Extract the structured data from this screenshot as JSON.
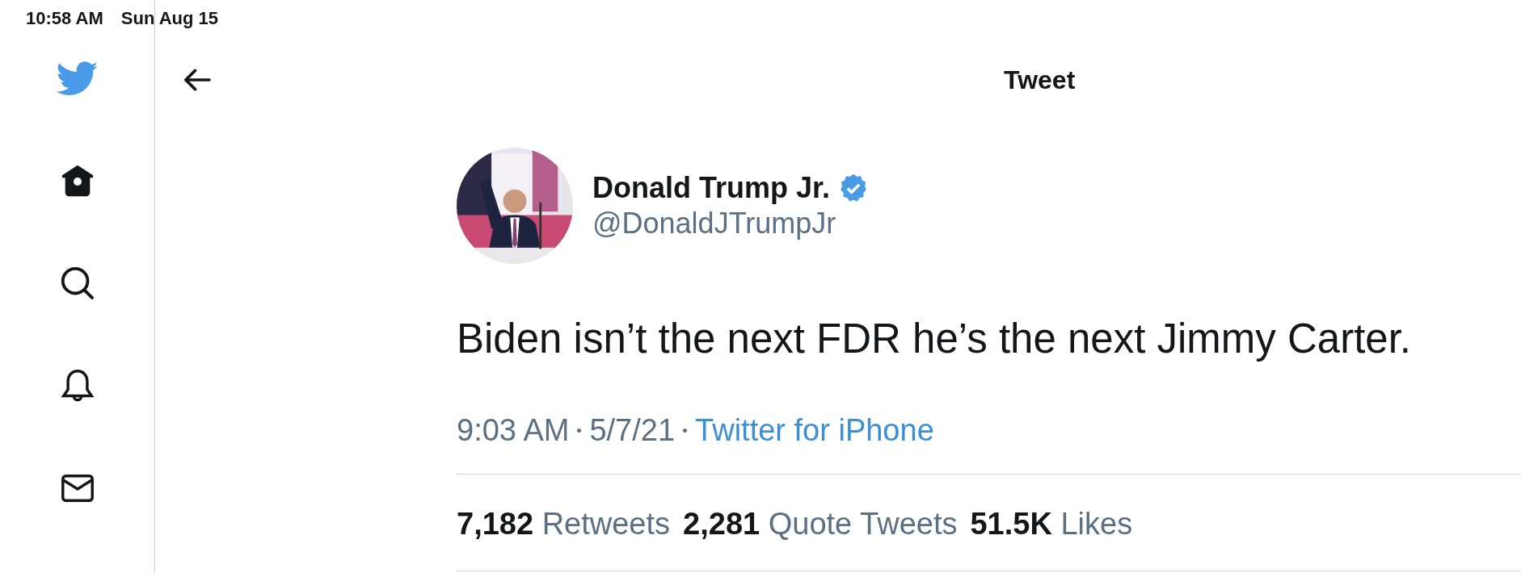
{
  "status_bar": {
    "time": "10:58 AM",
    "date": "Sun Aug 15"
  },
  "header": {
    "title": "Tweet"
  },
  "tweet": {
    "author": {
      "name": "Donald Trump Jr.",
      "verified": true,
      "handle": "@DonaldJTrumpJr"
    },
    "text": "Biden isn’t the next FDR he’s the next Jimmy Carter.",
    "time": "9:03 AM",
    "date": "5/7/21",
    "source": "Twitter for iPhone"
  },
  "stats": [
    {
      "count": "7,182",
      "label": "Retweets"
    },
    {
      "count": "2,281",
      "label": "Quote Tweets"
    },
    {
      "count": "51.5K",
      "label": "Likes"
    }
  ]
}
